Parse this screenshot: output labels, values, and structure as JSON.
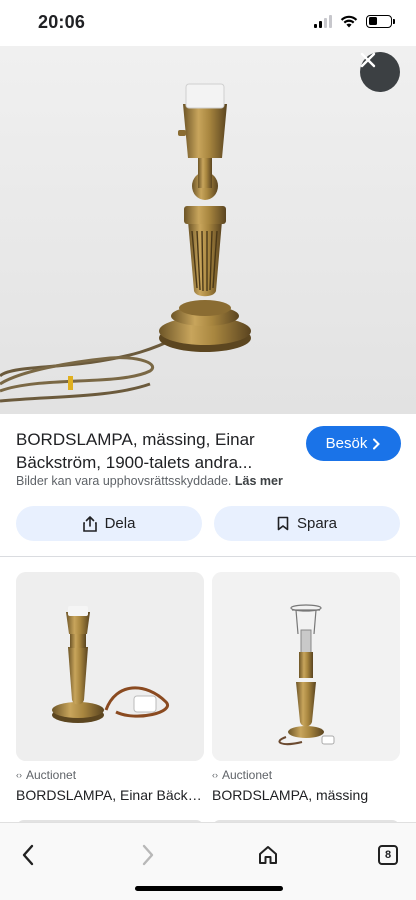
{
  "status_bar": {
    "time": "20:06"
  },
  "hero": {
    "close_icon": "close-icon"
  },
  "result": {
    "title": "BORDSLAMPA, mässing, Einar Bäckström, 1900-talets andra...",
    "visit_label": "Besök",
    "copyright_text": "Bilder kan vara upphovsrättsskyddade.",
    "read_more": "Läs mer"
  },
  "actions": {
    "share_label": "Dela",
    "save_label": "Spara"
  },
  "related": [
    {
      "source": "Auctionet",
      "title": "BORDSLAMPA, Einar Bäckström"
    },
    {
      "source": "Auctionet",
      "title": "BORDSLAMPA, mässing"
    }
  ],
  "toolbar": {
    "tab_count": "8"
  },
  "colors": {
    "accent": "#1a73e8",
    "chip": "#e8f0fe"
  }
}
